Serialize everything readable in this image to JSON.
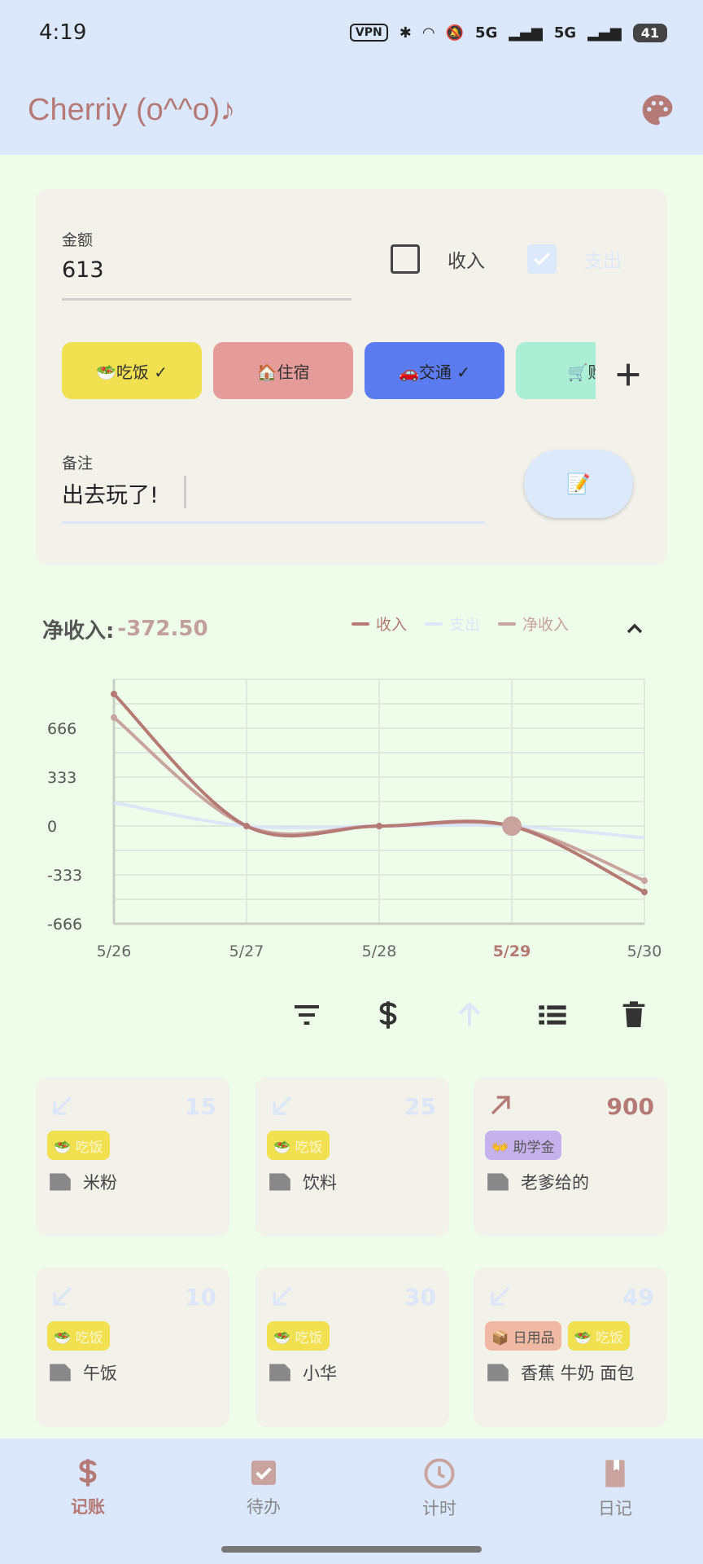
{
  "status_bar": {
    "time": "4:19",
    "vpn": "VPN",
    "net1": "5G",
    "net2": "5G",
    "battery": "41"
  },
  "app_bar": {
    "title": "Cherriy (o^^o)♪"
  },
  "form": {
    "amount_label": "金额",
    "amount_value": "613",
    "income_label": "收入",
    "expense_label": "支出",
    "income_checked": false,
    "expense_checked": true,
    "categories": [
      {
        "label": "🥗吃饭 ✓",
        "color": "#f1e04f"
      },
      {
        "label": "🏠住宿",
        "color": "#e59b99"
      },
      {
        "label": "🚗交通 ✓",
        "color": "#5b7bf0"
      },
      {
        "label": "🛒购",
        "color": "#a9eed5"
      }
    ],
    "add_icon": "plus-icon",
    "note_label": "备注",
    "note_value": "出去玩了!",
    "note_button": "📝"
  },
  "summary": {
    "net_label": "净收入:",
    "net_value": "-372.50",
    "legend": [
      {
        "name": "收入",
        "color": "#b57a76"
      },
      {
        "name": "支出",
        "color": "#dbe6f8"
      },
      {
        "name": "净收入",
        "color": "#c9a39e"
      }
    ]
  },
  "chart_data": {
    "type": "line",
    "x": [
      "5/26",
      "5/27",
      "5/28",
      "5/29",
      "5/30"
    ],
    "highlighted_x": "5/29",
    "yticks": [
      "666",
      "333",
      "0",
      "-333",
      "-666"
    ],
    "ylim": [
      -666,
      1000
    ],
    "grid": true,
    "series": [
      {
        "name": "收入",
        "color": "#b57a76",
        "values": [
          900,
          0,
          0,
          0,
          -450
        ]
      },
      {
        "name": "支出",
        "color": "#dbe6f8",
        "values": [
          160,
          0,
          0,
          0,
          -80
        ]
      },
      {
        "name": "净收入",
        "color": "#c9a39e",
        "values": [
          740,
          0,
          0,
          0,
          -372.5
        ]
      }
    ]
  },
  "toolbar": {
    "icons": [
      "filter-icon",
      "dollar-icon",
      "sort-up-icon",
      "list-icon",
      "delete-icon"
    ]
  },
  "transactions": [
    {
      "direction": "out",
      "amount": "15",
      "tags": [
        {
          "label": "🥗 吃饭",
          "color": "#f1e04f"
        }
      ],
      "note": "米粉"
    },
    {
      "direction": "out",
      "amount": "25",
      "tags": [
        {
          "label": "🥗 吃饭",
          "color": "#f1e04f"
        }
      ],
      "note": "饮料"
    },
    {
      "direction": "in",
      "amount": "900",
      "tags": [
        {
          "label": "👐 助学金",
          "color": "#c5b2ec"
        }
      ],
      "note": "老爹给的"
    },
    {
      "direction": "out",
      "amount": "10",
      "tags": [
        {
          "label": "🥗 吃饭",
          "color": "#f1e04f"
        }
      ],
      "note": "午饭"
    },
    {
      "direction": "out",
      "amount": "30",
      "tags": [
        {
          "label": "🥗 吃饭",
          "color": "#f1e04f"
        }
      ],
      "note": "小华"
    },
    {
      "direction": "out",
      "amount": "49",
      "tags": [
        {
          "label": "📦 日用品",
          "color": "#f0b9a3"
        },
        {
          "label": "🥗 吃饭",
          "color": "#f1e04f"
        }
      ],
      "note": "香蕉 牛奶 面包"
    }
  ],
  "nav": [
    {
      "label": "记账",
      "icon": "dollar-icon",
      "active": true
    },
    {
      "label": "待办",
      "icon": "checkbox-icon",
      "active": false
    },
    {
      "label": "计时",
      "icon": "clock-icon",
      "active": false
    },
    {
      "label": "日记",
      "icon": "book-icon",
      "active": false
    }
  ]
}
